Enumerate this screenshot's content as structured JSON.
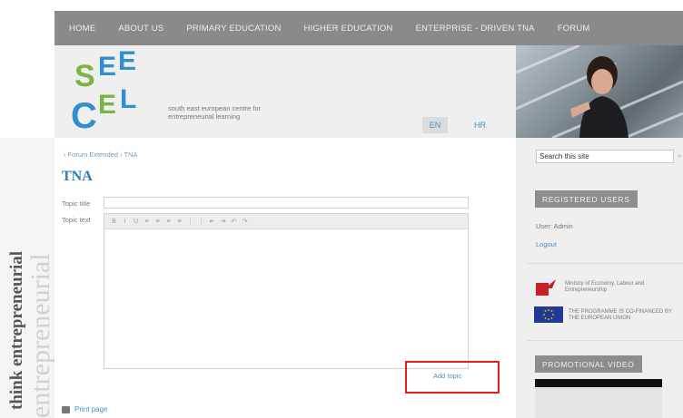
{
  "nav": {
    "items": [
      "HOME",
      "ABOUT US",
      "PRIMARY EDUCATION",
      "HIGHER EDUCATION",
      "ENTERPRISE - DRIVEN TNA",
      "FORUM"
    ]
  },
  "header": {
    "logo": {
      "line1": "SEE",
      "line2": "CEL",
      "colors": {
        "green": "#7ab442",
        "blue": "#2f8fcf"
      }
    },
    "tagline": "south east european centre for entrepreneurial learning",
    "lang_en": "EN",
    "lang_hr": "HR"
  },
  "side_text": {
    "line1": "think entrepreneurial",
    "line2": "entrepreneurial"
  },
  "main": {
    "breadcrumb": "› Forum Extended › TNA",
    "title": "TNA",
    "topic_title_label": "Topic title",
    "topic_text_label": "Topic text",
    "toolbar_buttons": [
      "B",
      "I",
      "U",
      "≡",
      "≡",
      "≡",
      "≡",
      "⋮",
      "⋮",
      "⇤",
      "⇥",
      "↶",
      "↷"
    ],
    "add_topic": "Add topic",
    "print_page": "Print page"
  },
  "sidebar": {
    "search_placeholder": "Search this site",
    "search_go": "»",
    "registered_heading": "REGISTERED USERS",
    "user_line": "User: Admin",
    "logout": "Logout",
    "ministry_text": "Ministry of Economy, Labour and Entrepreneurship",
    "eu_text": "THE PROGRAMME IS CO-FINANCED BY THE EUROPEAN UNION",
    "video_heading": "PROMOTIONAL VIDEO"
  },
  "colors": {
    "accent_blue": "#2f7bb8",
    "link_blue": "#4c8fc3",
    "nav_gray": "#8a8a8a",
    "highlight_red": "#e02020"
  }
}
